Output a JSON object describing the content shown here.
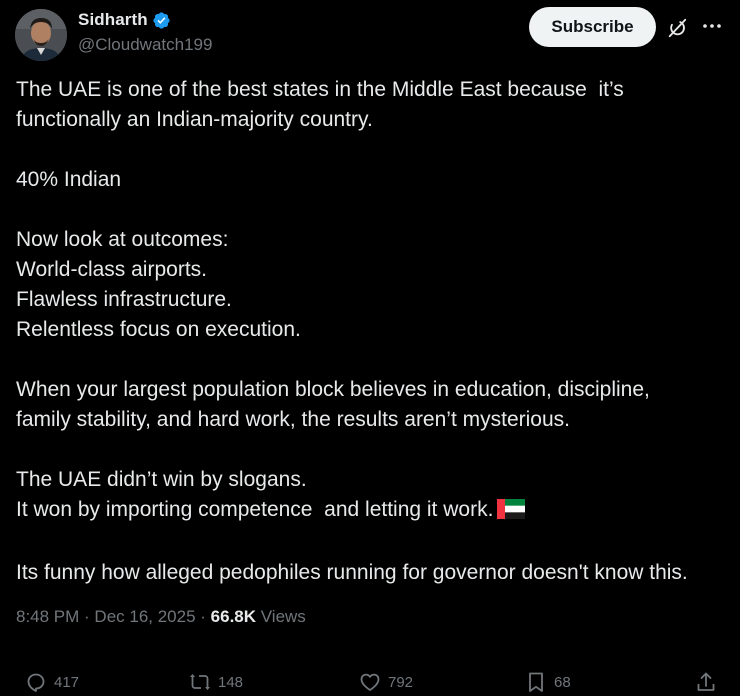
{
  "author": {
    "display_name": "Sidharth",
    "handle": "@Cloudwatch199",
    "verified": true
  },
  "subscribe_label": "Subscribe",
  "tweet": {
    "paragraphs": [
      [
        "The UAE is one of the best states in the Middle East because  it’s",
        "functionally an Indian-majority country."
      ],
      [
        "40% Indian"
      ],
      [
        "Now look at outcomes:",
        "World-class airports.",
        "Flawless infrastructure.",
        "Relentless focus on execution."
      ],
      [
        "When your largest population block believes in education, discipline,",
        "family stability, and hard work, the results aren’t mysterious."
      ],
      [
        "The UAE didn’t win by slogans.",
        "It won by importing competence  and letting it work."
      ],
      [
        "Its funny how alleged pedophiles running for governor doesn't know this."
      ]
    ]
  },
  "meta": {
    "time": "8:48 PM",
    "separator": " · ",
    "date": "Dec 16, 2025",
    "views_count": "66.8K",
    "views_label": " Views"
  },
  "actions": {
    "replies": "417",
    "reposts": "148",
    "likes": "792",
    "bookmarks": "68"
  },
  "colors": {
    "background": "#000000",
    "text": "#e7e9ea",
    "muted": "#71767b",
    "verified": "#1d9bf0",
    "subscribe_bg": "#eff3f4"
  },
  "icons": {
    "verified": "verified-badge-icon",
    "grok": "grok-icon",
    "more": "more-icon",
    "flag": "uae-flag-icon",
    "reply": "reply-icon",
    "repost": "repost-icon",
    "like": "heart-icon",
    "bookmark": "bookmark-icon",
    "share": "share-icon"
  }
}
